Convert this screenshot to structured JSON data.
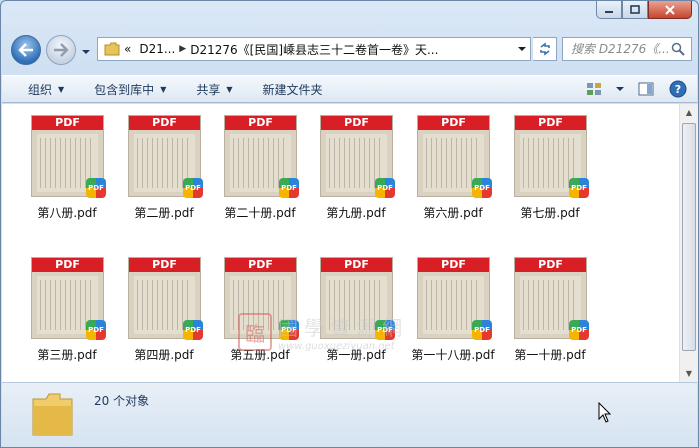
{
  "window": {
    "caption_buttons": [
      "minimize",
      "maximize",
      "close"
    ]
  },
  "address": {
    "overflow_chevron": "«",
    "crumbs": [
      "D21...",
      "D21276《[民国]嵊县志三十二卷首一卷》天..."
    ],
    "search_placeholder": "搜索 D21276《..."
  },
  "toolbar": {
    "items": [
      {
        "label": "组织",
        "has_dropdown": true
      },
      {
        "label": "包含到库中",
        "has_dropdown": true
      },
      {
        "label": "共享",
        "has_dropdown": true
      },
      {
        "label": "新建文件夹",
        "has_dropdown": false
      }
    ],
    "icons": [
      "view-options-icon",
      "preview-pane-icon",
      "help-icon"
    ]
  },
  "files": [
    {
      "name": "第八册.pdf"
    },
    {
      "name": "第二册.pdf"
    },
    {
      "name": "第二十册.pdf"
    },
    {
      "name": "第九册.pdf"
    },
    {
      "name": "第六册.pdf"
    },
    {
      "name": "第七册.pdf"
    },
    {
      "name": "第三册.pdf"
    },
    {
      "name": "第四册.pdf"
    },
    {
      "name": "第五册.pdf"
    },
    {
      "name": "第一册.pdf"
    },
    {
      "name": "第一十八册.pdf"
    },
    {
      "name": "第一十册.pdf"
    }
  ],
  "thumbnail_band_label": "PDF",
  "badge_label": "PDF",
  "watermark": {
    "seal": "臨",
    "text": "國學資源網",
    "url": "www.guoxueziyuan.net"
  },
  "status": {
    "count_text": "20 个对象"
  },
  "colors": {
    "pdf_red": "#d71f25",
    "accent_blue": "#2f6fb5"
  }
}
